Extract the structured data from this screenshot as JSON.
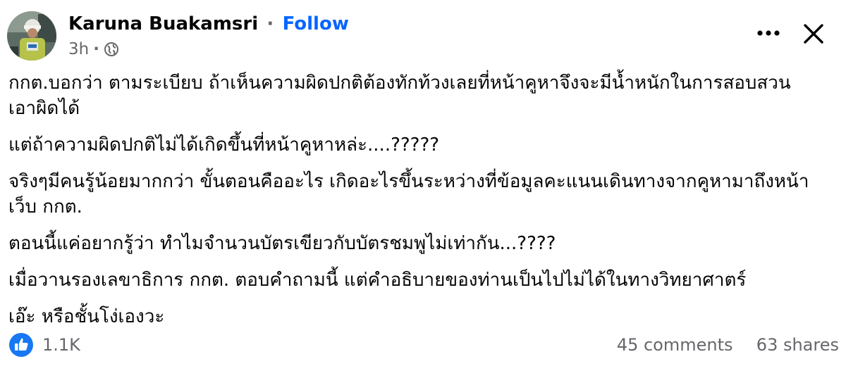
{
  "post": {
    "author": "Karuna Buakamsri",
    "separator": "·",
    "follow_label": "Follow",
    "time": "3h",
    "meta_separator": "·",
    "privacy_icon": "globe-icon",
    "paragraphs": [
      "กกต.บอกว่า ตามระเบียบ ถ้าเห็นความผิดปกติต้องทักท้วงเลยที่หน้าคูหาจึงจะมีน้ำหนักในการสอบสวนเอาผิดได้",
      "แต่ถ้าความผิดปกติไม่ได้เกิดขึ้นที่หน้าคูหาหล่ะ....?????",
      "จริงๆมีคนรู้น้อยมากกว่า ขั้นตอนคืออะไร เกิดอะไรขึ้นระหว่างที่ข้อมูลคะแนนเดินทางจากคูหามาถึงหน้าเว็บ กกต.",
      "ตอนนี้แค่อยากรู้ว่า ทำไมจำนวนบัตรเขียวกับบัตรชมพูไม่เท่ากัน...????",
      "เมื่อวานรองเลขาธิการ กกต. ตอบคำถามนี้ แต่คำอธิบายของท่านเป็นไปไม่ได้ในทางวิทยาศาตร์",
      "เอ๊ะ หรือชั้นโง่เองวะ"
    ]
  },
  "footer": {
    "like_count": "1.1K",
    "comments": "45 comments",
    "shares": "63 shares"
  },
  "colors": {
    "text": "#050505",
    "secondary": "#65676b",
    "accent": "#0866ff"
  },
  "icons": {
    "more": "more-horizontal-icon",
    "close": "close-icon",
    "like": "like-thumb-icon"
  }
}
